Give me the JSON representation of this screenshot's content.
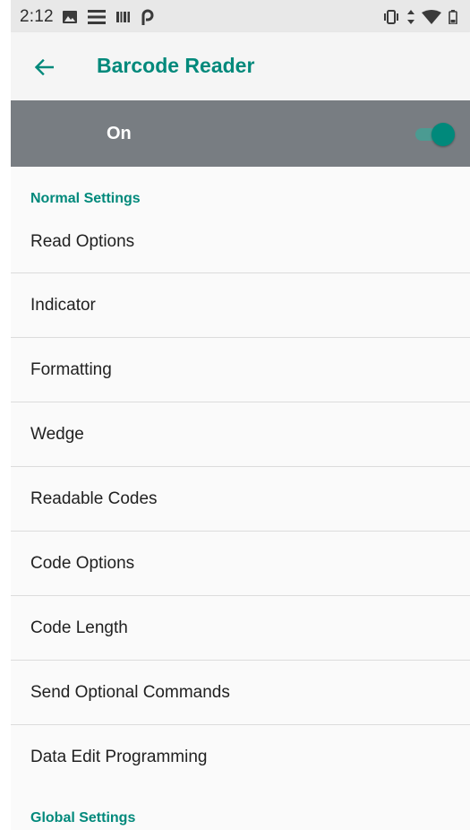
{
  "status_bar": {
    "time": "2:12",
    "icons_left": [
      "image-icon",
      "menu-lines-icon",
      "barcode-icon",
      "p-icon"
    ],
    "icons_right": [
      "vibrate-icon",
      "data-arrows-icon",
      "wifi-icon",
      "battery-icon"
    ]
  },
  "app_bar": {
    "back_icon": "arrow-left-icon",
    "title": "Barcode Reader"
  },
  "master_switch": {
    "label": "On",
    "state": "on"
  },
  "sections": {
    "normal": {
      "header": "Normal Settings",
      "items": [
        "Read Options",
        "Indicator",
        "Formatting",
        "Wedge",
        "Readable Codes",
        "Code Options",
        "Code Length",
        "Send Optional Commands",
        "Data Edit Programming"
      ]
    },
    "global": {
      "header": "Global Settings"
    }
  },
  "colors": {
    "accent": "#00897b",
    "switch_bar": "#787d82",
    "background": "#fafafa",
    "status_bar": "#e8e8e8"
  }
}
